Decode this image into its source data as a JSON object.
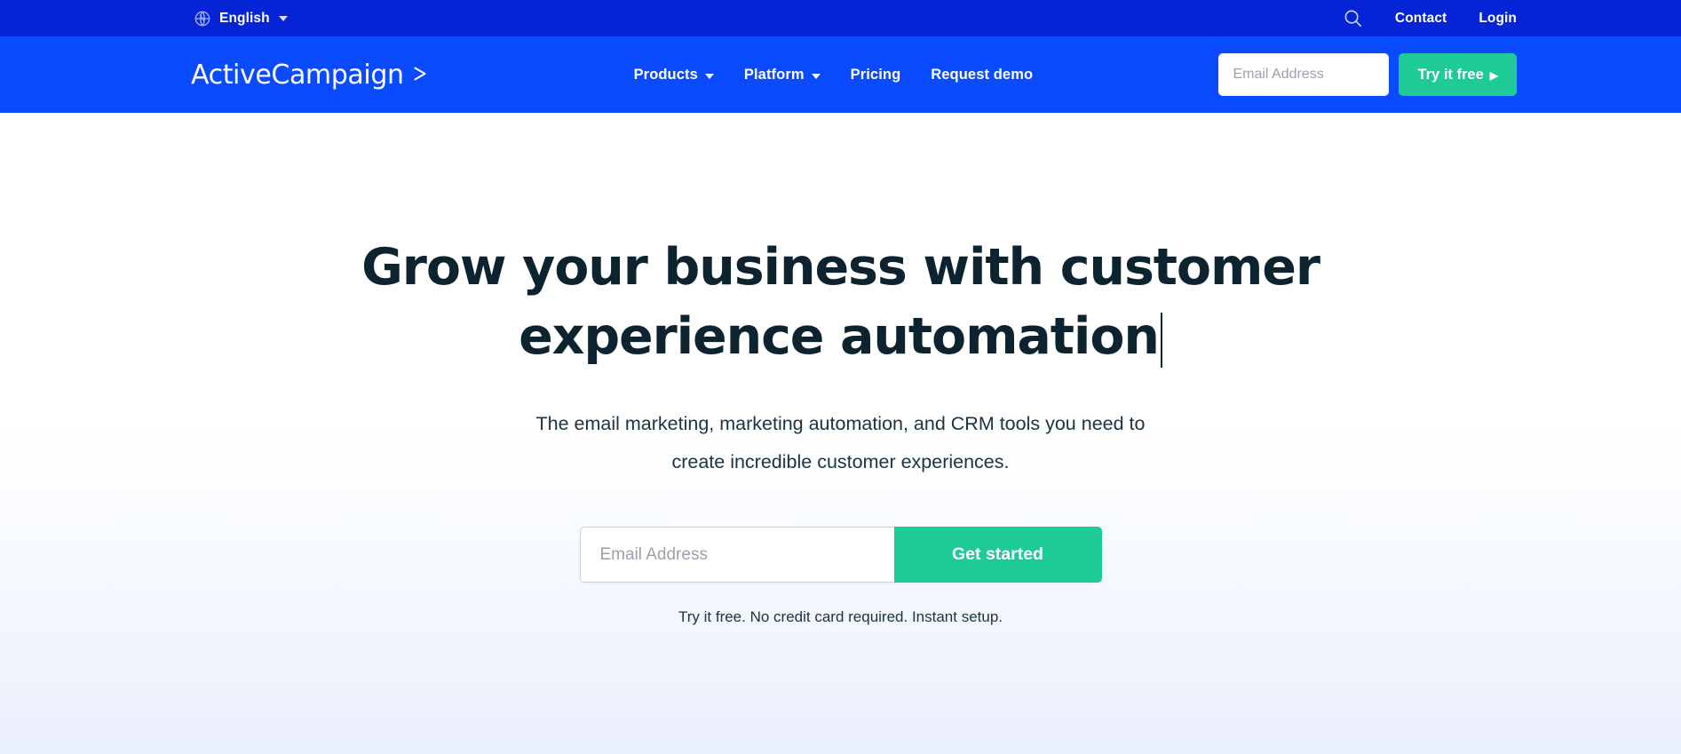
{
  "utility_bar": {
    "language": {
      "icon": "globe-icon",
      "label": "English",
      "caret": "chevron-down-icon"
    },
    "search_icon": "search-icon",
    "links": [
      {
        "label": "Contact"
      },
      {
        "label": "Login"
      }
    ]
  },
  "main_nav": {
    "brand": {
      "name": "ActiveCampaign",
      "mark": "chevron-right-mark"
    },
    "links": [
      {
        "label": "Products",
        "has_dropdown": true
      },
      {
        "label": "Platform",
        "has_dropdown": true
      },
      {
        "label": "Pricing",
        "has_dropdown": false
      },
      {
        "label": "Request demo",
        "has_dropdown": false
      }
    ],
    "email_field": {
      "placeholder": "Email Address",
      "value": ""
    },
    "cta": {
      "label": "Try it free",
      "arrow": "▶"
    }
  },
  "hero": {
    "title_line_1": "Grow your business with customer",
    "title_line_2": "experience automation",
    "subtitle_line_1": "The email marketing, marketing automation, and CRM tools you need to",
    "subtitle_line_2": "create incredible customer experiences.",
    "form": {
      "email_placeholder": "Email Address",
      "email_value": "",
      "submit_label": "Get started"
    },
    "note": "Try it free. No credit card required. Instant setup."
  },
  "colors": {
    "utility_bar_bg": "#0524d6",
    "nav_bar_bg": "#0b4bff",
    "cta_green": "#1ecb96",
    "heading_navy": "#0d2430",
    "hero_gradient_bottom": "#e9effc"
  }
}
